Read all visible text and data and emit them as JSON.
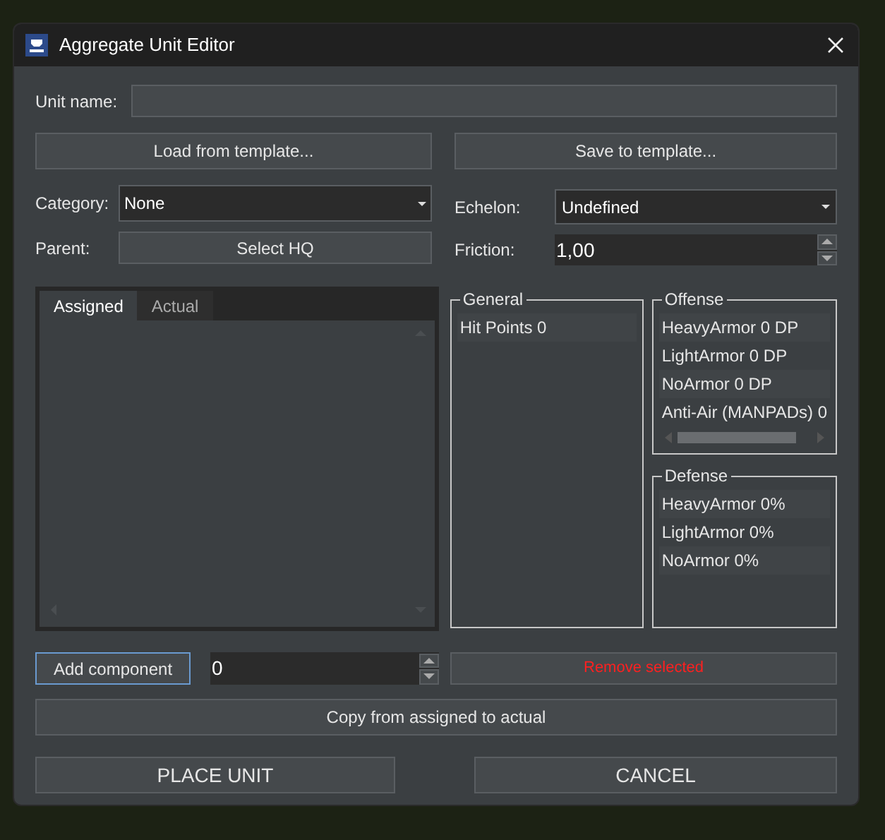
{
  "window": {
    "title": "Aggregate Unit Editor"
  },
  "unit_name": {
    "label": "Unit name:"
  },
  "template_buttons": [
    {
      "label": "Load from template..."
    },
    {
      "label": "Save to template..."
    }
  ],
  "category": {
    "label": "Category:",
    "value": "None"
  },
  "echelon": {
    "label": "Echelon:",
    "value": "Undefined"
  },
  "parent": {
    "label": "Parent:",
    "button": "Select HQ"
  },
  "friction": {
    "label": "Friction:",
    "value": "1,00"
  },
  "component_tabs": [
    {
      "label": "Assigned",
      "selected": true
    },
    {
      "label": "Actual",
      "selected": false
    }
  ],
  "groups": [
    {
      "title": "General",
      "items": [
        "Hit Points 0"
      ],
      "horizontal_scroll": false
    },
    {
      "title": "Offense",
      "items": [
        "HeavyArmor 0 DP",
        "LightArmor 0 DP",
        "NoArmor 0 DP",
        "Anti-Air (MANPADs) 0"
      ],
      "horizontal_scroll": true
    },
    {
      "title": "Defense",
      "items": [
        "HeavyArmor 0%",
        "LightArmor 0%",
        "NoArmor 0%"
      ],
      "horizontal_scroll": false
    }
  ],
  "add_component": {
    "label": "Add component",
    "focused": true
  },
  "count": {
    "value": "0"
  },
  "remove_button": {
    "label": "Remove selected",
    "kind": "danger"
  },
  "copy_button": {
    "label": "Copy from assigned to actual"
  },
  "footer_buttons": [
    {
      "label": "PLACE UNIT"
    },
    {
      "label": "CANCEL"
    }
  ]
}
